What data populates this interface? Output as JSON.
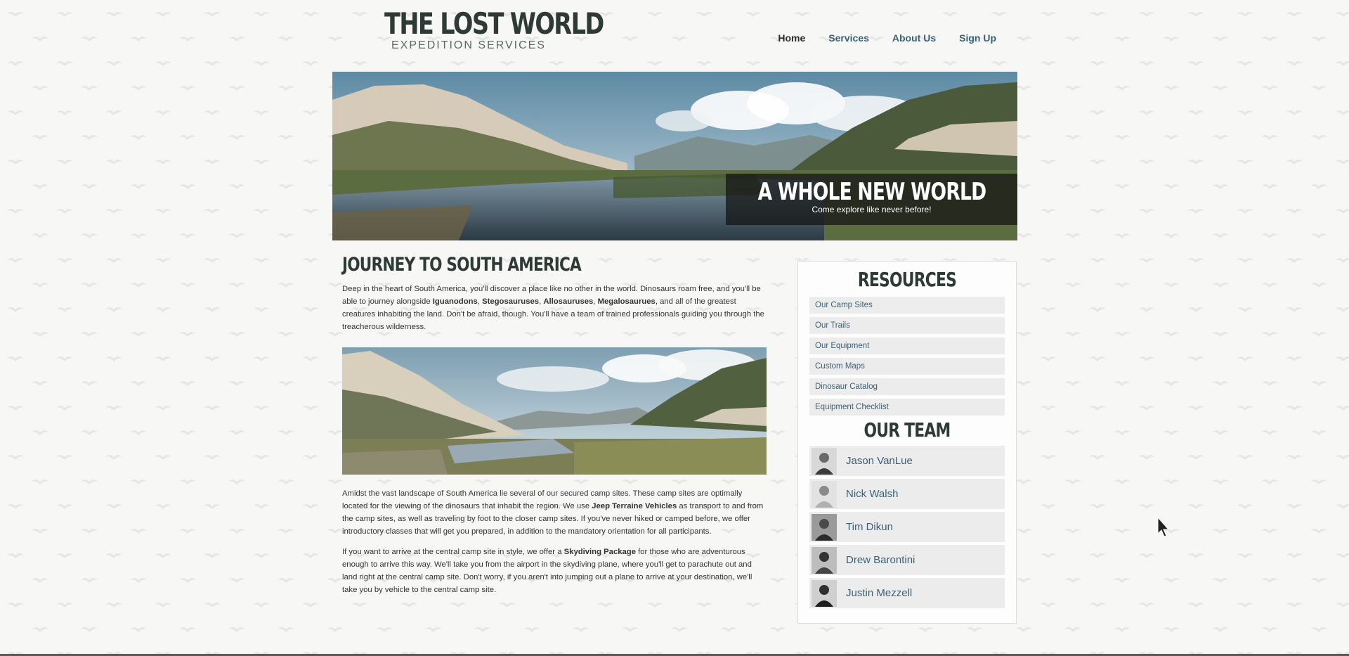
{
  "header": {
    "logo_title": "THE LOST WORLD",
    "logo_subtitle": "EXPEDITION SERVICES",
    "nav": [
      {
        "label": "Home",
        "active": true
      },
      {
        "label": "Services",
        "active": false
      },
      {
        "label": "About Us",
        "active": false
      },
      {
        "label": "Sign Up",
        "active": false
      }
    ]
  },
  "hero": {
    "title": "A WHOLE NEW WORLD",
    "subtitle": "Come explore like never before!"
  },
  "main": {
    "heading": "JOURNEY TO SOUTH AMERICA",
    "p1": {
      "t1": "Deep in the heart of South America, you'll discover a place like no other in the world. Dinosaurs roam free, and you'll be able to journey alongside ",
      "b1": "Iguanodons",
      "s1": ", ",
      "b2": "Stegosauruses",
      "s2": ", ",
      "b3": "Allosauruses",
      "s3": ", ",
      "b4": "Megalosaurues",
      "t2": ", and all of the greatest creatures inhabiting the land. Don't be afraid, though. You'll have a team of trained professionals guiding you through the treacherous wilderness."
    },
    "p2": {
      "t1": "Amidst the vast landscape of South America lie several of our secured camp sites. These camp sites are optimally located for the viewing of the dinosaurs that inhabit the region. We use ",
      "b1": "Jeep Terraine Vehicles",
      "t2": " as transport to and from the camp sites, as well as traveling by foot to the closer camp sites. If you've never hiked or camped before, we offer introductory classes that will get you prepared, in addition to the mandatory orientation for all participants."
    },
    "p3": {
      "t1": "If you want to arrive at the central camp site in style, we offer a ",
      "b1": "Skydiving Package",
      "t2": " for those who are adventurous enough to arrive this way. We'll take you from the airport in the skydiving plane, where you'll get to parachute out and land right at the central camp site. Don't worry, if you aren't into jumping out a plane to arrive at your destination, we'll take you by vehicle to the central camp site."
    }
  },
  "sidebar": {
    "resources_title": "RESOURCES",
    "resources": [
      "Our Camp Sites",
      "Our Trails",
      "Our Equipment",
      "Custom Maps",
      "Dinosaur Catalog",
      "Equipment Checklist"
    ],
    "team_title": "OUR TEAM",
    "team": [
      "Jason VanLue",
      "Nick Walsh",
      "Tim Dikun",
      "Drew Barontini",
      "Justin Mezzell"
    ]
  }
}
